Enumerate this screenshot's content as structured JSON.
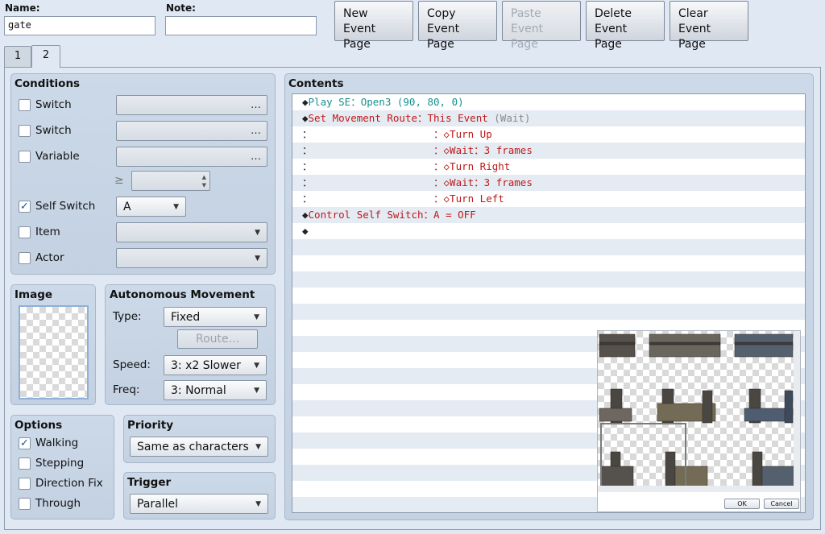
{
  "header": {
    "name_label": "Name:",
    "name_value": "gate",
    "note_label": "Note:",
    "note_value": ""
  },
  "toolbar": {
    "new": [
      "New",
      "Event Page"
    ],
    "copy": [
      "Copy",
      "Event Page"
    ],
    "paste": [
      "Paste",
      "Event Page"
    ],
    "delete": [
      "Delete",
      "Event Page"
    ],
    "clear": [
      "Clear",
      "Event Page"
    ]
  },
  "tabs": [
    "1",
    "2"
  ],
  "conditions": {
    "title": "Conditions",
    "switch1_label": "Switch",
    "switch2_label": "Switch",
    "variable_label": "Variable",
    "gte": "≥",
    "self_switch_label": "Self Switch",
    "self_switch_value": "A",
    "item_label": "Item",
    "actor_label": "Actor",
    "ellipsis": "…"
  },
  "image": {
    "title": "Image"
  },
  "movement": {
    "title": "Autonomous Movement",
    "type_label": "Type:",
    "type_value": "Fixed",
    "route_button": "Route...",
    "speed_label": "Speed:",
    "speed_value": "3: x2 Slower",
    "freq_label": "Freq:",
    "freq_value": "3: Normal"
  },
  "options": {
    "title": "Options",
    "walking": "Walking",
    "stepping": "Stepping",
    "direction_fix": "Direction Fix",
    "through": "Through",
    "walking_checked": true,
    "stepping_checked": false,
    "direction_fix_checked": false,
    "through_checked": false
  },
  "priority": {
    "title": "Priority",
    "value": "Same as characters"
  },
  "trigger": {
    "title": "Trigger",
    "value": "Parallel"
  },
  "contents": {
    "title": "Contents",
    "lines": [
      {
        "prefix": "◆",
        "text": "Play SE：Open3 (90, 80, 0)",
        "color": "teal"
      },
      {
        "prefix": "◆",
        "text": "Set Movement Route：This Event",
        "extra": " (Wait)",
        "color": "red"
      },
      {
        "prefix": "：",
        "text": "                    ：◇Turn Up",
        "color": "red"
      },
      {
        "prefix": "：",
        "text": "                    ：◇Wait：3 frames",
        "color": "red"
      },
      {
        "prefix": "：",
        "text": "                    ：◇Turn Right",
        "color": "red"
      },
      {
        "prefix": "：",
        "text": "                    ：◇Wait：3 frames",
        "color": "red"
      },
      {
        "prefix": "：",
        "text": "                    ：◇Turn Left",
        "color": "red"
      },
      {
        "prefix": "◆",
        "text": "Control Self Switch：A = OFF",
        "color": "red"
      },
      {
        "prefix": "◆",
        "text": "",
        "color": "red"
      }
    ]
  },
  "tile_picker": {
    "ok": "OK",
    "cancel": "Cancel"
  },
  "colors": {
    "teal": "#16908f",
    "red": "#c01818"
  }
}
